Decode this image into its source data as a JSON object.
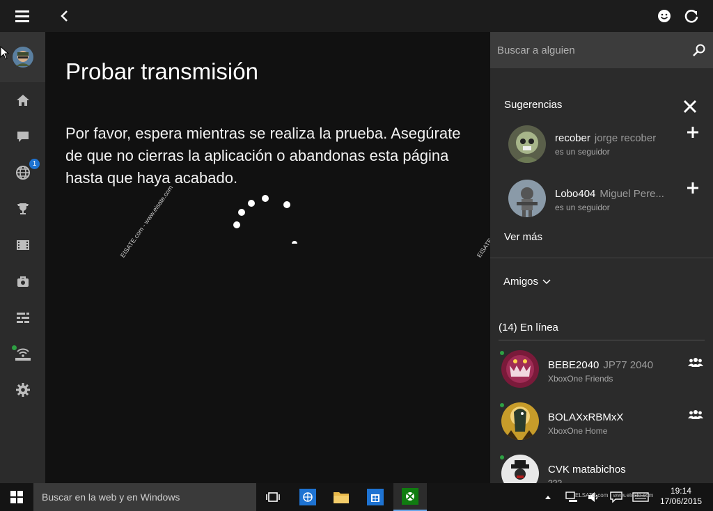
{
  "main": {
    "title": "Probar transmisión",
    "message": "Por favor, espera mientras se realiza la prueba. Asegúrate de que no cierras la aplicación o abandonas esta página hasta que haya acabado."
  },
  "rail": {
    "messages_badge": "1"
  },
  "watermark": "EISATE.com - www.eisate.com",
  "panel": {
    "search_placeholder": "Buscar a alguien",
    "suggestions_title": "Sugerencias",
    "suggestions": [
      {
        "gamertag": "recober",
        "real_name": "jorge recober",
        "subtitle": "es un seguidor"
      },
      {
        "gamertag": "Lobo404",
        "real_name": "Miguel Pere...",
        "subtitle": "es un seguidor"
      }
    ],
    "see_more": "Ver más",
    "friends_label": "Amigos",
    "online_label": "(14) En línea",
    "friends": [
      {
        "gamertag": "BEBE2040",
        "real_name": "JP77 2040",
        "status": "XboxOne Friends"
      },
      {
        "gamertag": "BOLAXxRBMxX",
        "real_name": "",
        "status": "XboxOne Home"
      },
      {
        "gamertag": "CVK matabichos",
        "real_name": "",
        "status": "???"
      }
    ]
  },
  "taskbar": {
    "search_placeholder": "Buscar en la web y en Windows",
    "time": "19:14",
    "date": "17/06/2015",
    "tray_watermark": "ELSATE.com - www.elsate.com"
  },
  "colors": {
    "accent_blue": "#1e73d2",
    "online_green": "#2ea043",
    "xbox_green": "#107c10"
  }
}
